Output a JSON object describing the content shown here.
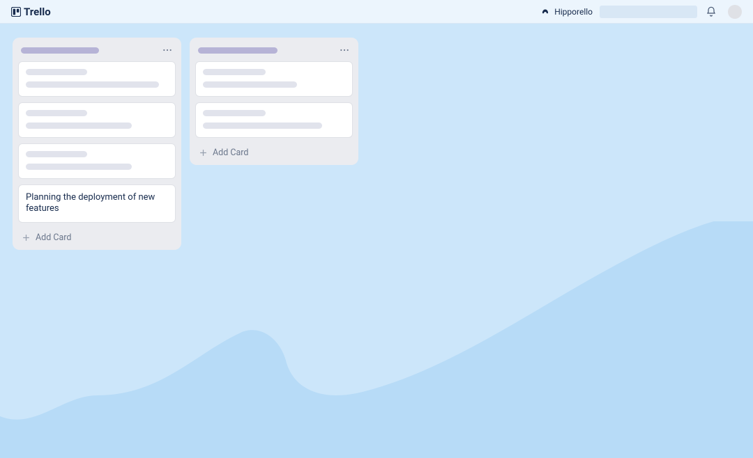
{
  "header": {
    "brand": "Trello",
    "powerup_label": "Hipporello"
  },
  "board": {
    "lists": [
      {
        "cards": [
          {
            "placeholder": true
          },
          {
            "placeholder": true
          },
          {
            "placeholder": true
          },
          {
            "placeholder": false,
            "text": "Planning the deployment of new features"
          }
        ],
        "add_label": "Add Card"
      },
      {
        "cards": [
          {
            "placeholder": true
          },
          {
            "placeholder": true
          }
        ],
        "add_label": "Add Card"
      }
    ]
  }
}
